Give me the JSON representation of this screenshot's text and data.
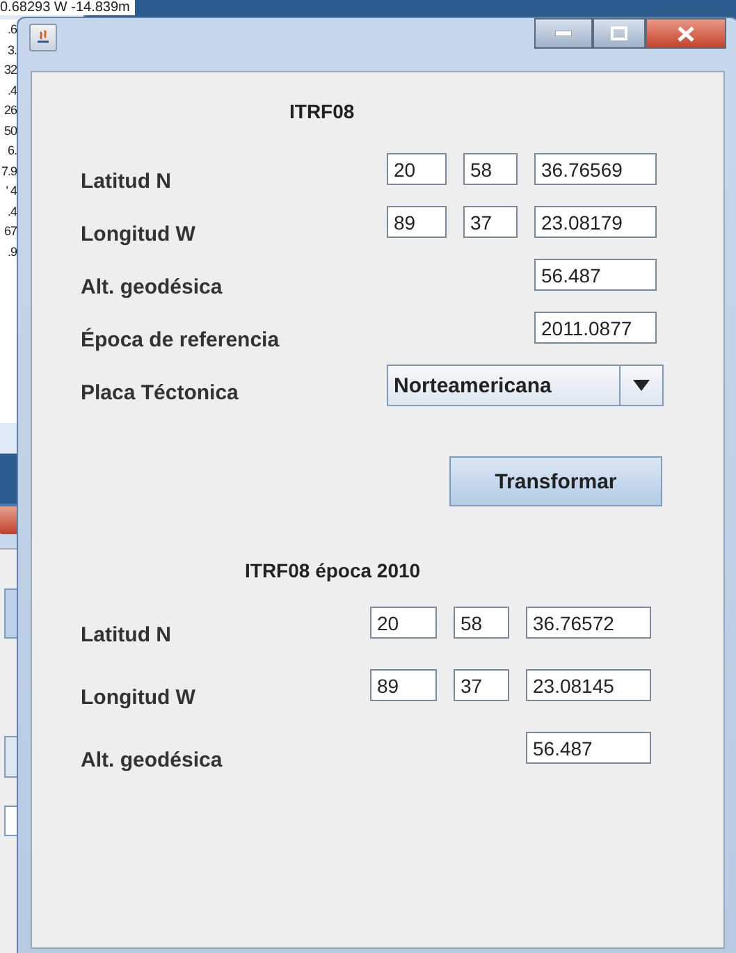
{
  "background_window": {
    "rows": [
      "0.68293  W  -14.839m",
      ".6",
      "3.",
      "32",
      ".4",
      "26",
      "50",
      "6.",
      "7.9",
      "' 4",
      ".4",
      "67",
      ".9"
    ]
  },
  "input_section": {
    "title": "ITRF08",
    "rows": [
      {
        "kind": "dms",
        "label": "Latitud N",
        "values": [
          "20",
          "58",
          "36.76569"
        ]
      },
      {
        "kind": "dms",
        "label": "Longitud W",
        "values": [
          "89",
          "37",
          "23.08179"
        ]
      },
      {
        "kind": "single",
        "label": "Alt. geodésica",
        "values": [
          "56.487"
        ]
      },
      {
        "kind": "single",
        "label": "Época de referencia",
        "values": [
          "2011.0877"
        ]
      },
      {
        "kind": "select",
        "label": "Placa Téctonica",
        "values": [
          "Norteamericana"
        ]
      }
    ]
  },
  "button": "Transformar",
  "output_section": {
    "title": "ITRF08 época 2010",
    "rows": [
      {
        "kind": "dms",
        "label": "Latitud N",
        "values": [
          "20",
          "58",
          "36.76572"
        ]
      },
      {
        "kind": "dms",
        "label": "Longitud W",
        "values": [
          "89",
          "37",
          "23.08145"
        ]
      },
      {
        "kind": "single",
        "label": "Alt. geodésica",
        "values": [
          "56.487"
        ]
      }
    ]
  }
}
